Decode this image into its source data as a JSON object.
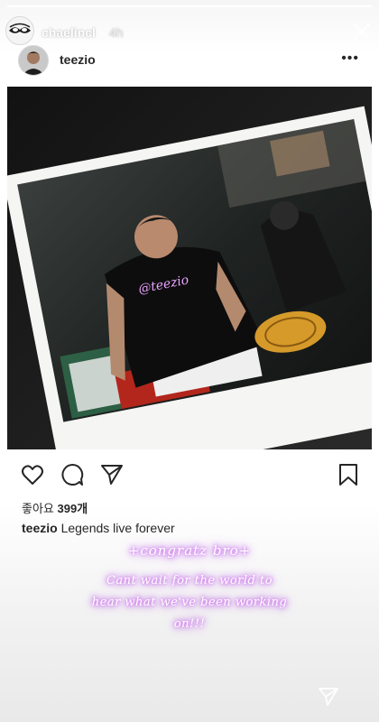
{
  "story": {
    "progress": 1,
    "username": "chaelincl",
    "time": "4h"
  },
  "post": {
    "username": "teezio",
    "more_label": "•••",
    "likes_label": "좋아요",
    "likes_count": "399개",
    "caption_user": "teezio",
    "caption_text": "Legends live forever"
  },
  "photo": {
    "shirt_text": "@teezio"
  },
  "overlay": {
    "title": "+congratz bro+",
    "lines": [
      "Cant wait for the world to",
      "hear what we've been working",
      "on!!!"
    ]
  },
  "icons": {
    "close": "close-icon",
    "heart": "heart-icon",
    "comment": "comment-icon",
    "share": "paper-plane-icon",
    "bookmark": "bookmark-icon",
    "send": "send-icon"
  }
}
